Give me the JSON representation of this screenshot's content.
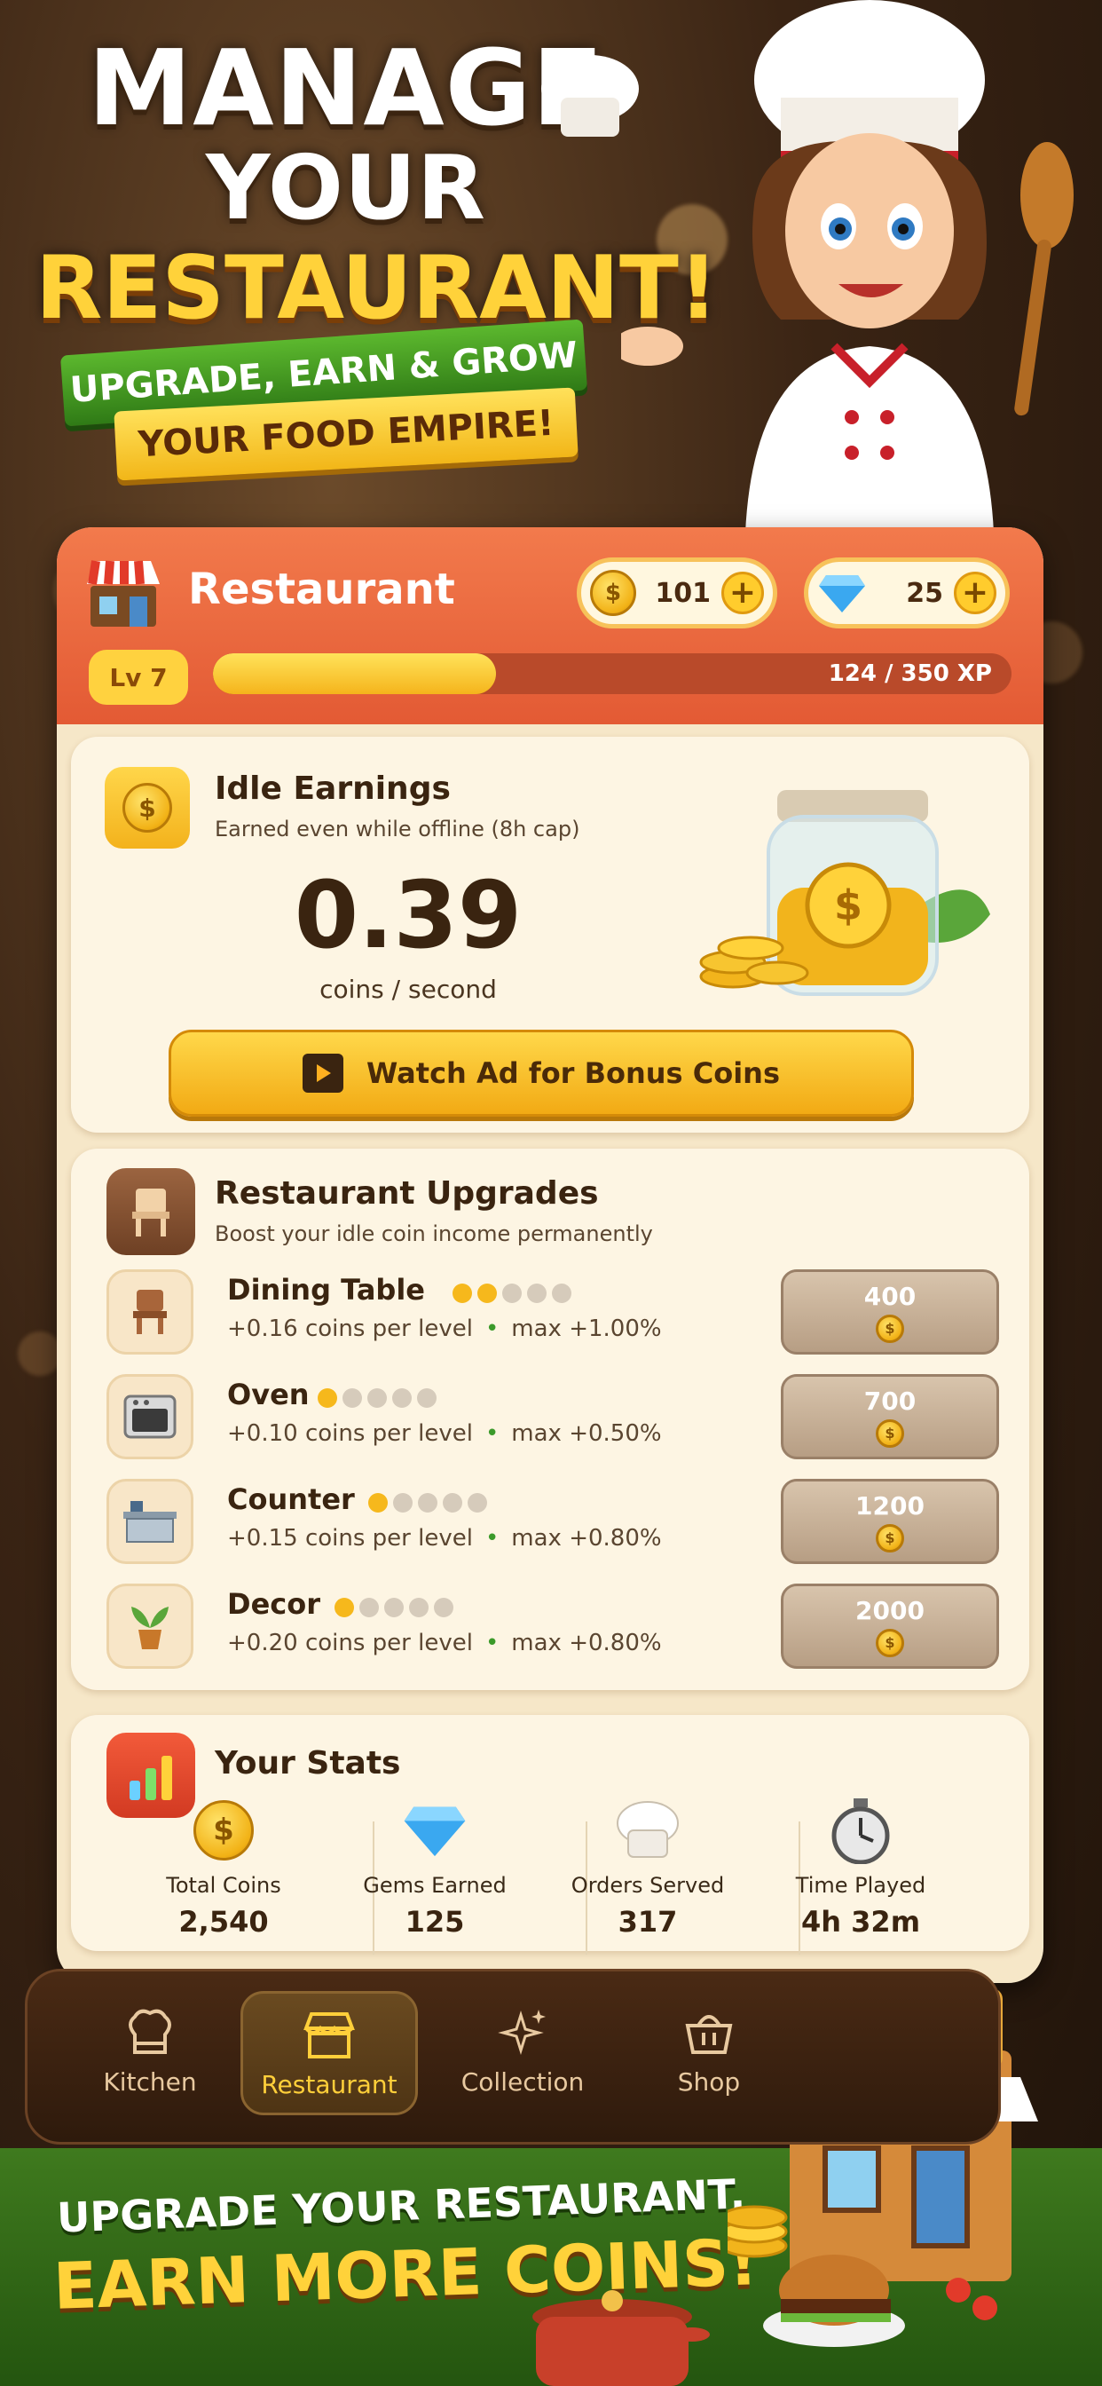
{
  "hero": {
    "title_line1": "MANAGE",
    "title_line2": "YOUR",
    "title_line3": "RESTAURANT!",
    "ribbon_line1": "UPGRADE, EARN & GROW",
    "ribbon_line2": "YOUR FOOD EMPIRE!"
  },
  "header": {
    "title": "Restaurant",
    "coins": "101",
    "gems": "25",
    "level": "Lv 7",
    "xp_text": "124 / 350 XP",
    "xp_progress": 0.354
  },
  "idle": {
    "title": "Idle Earnings",
    "subtitle": "Earned even while offline (8h cap)",
    "rate": "0.39",
    "unit": "coins / second",
    "ad_button": "Watch Ad for Bonus Coins"
  },
  "upgrades": {
    "title": "Restaurant Upgrades",
    "subtitle": "Boost your idle coin income permanently",
    "items": [
      {
        "name": "Dining Table",
        "level": 2,
        "max_level": 5,
        "per_level": "+0.16 coins per level",
        "max": "max +1.00%",
        "cost": "400",
        "icon": "chair-icon"
      },
      {
        "name": "Oven",
        "level": 1,
        "max_level": 5,
        "per_level": "+0.10 coins per level",
        "max": "max +0.50%",
        "cost": "700",
        "icon": "oven-icon"
      },
      {
        "name": "Counter",
        "level": 1,
        "max_level": 5,
        "per_level": "+0.15 coins per level",
        "max": "max +0.80%",
        "cost": "1200",
        "icon": "counter-icon"
      },
      {
        "name": "Decor",
        "level": 1,
        "max_level": 5,
        "per_level": "+0.20 coins per level",
        "max": "max +0.80%",
        "cost": "2000",
        "icon": "plant-icon"
      }
    ]
  },
  "stats": {
    "title": "Your Stats",
    "items": [
      {
        "label": "Total Coins",
        "value": "2,540",
        "icon": "coin-icon"
      },
      {
        "label": "Gems Earned",
        "value": "125",
        "icon": "gem-icon"
      },
      {
        "label": "Orders Served",
        "value": "317",
        "icon": "chef-hat-icon"
      },
      {
        "label": "Time Played",
        "value": "4h 32m",
        "icon": "stopwatch-icon"
      }
    ]
  },
  "nav": {
    "tabs": [
      {
        "label": "Kitchen",
        "icon": "chef-hat-icon"
      },
      {
        "label": "Restaurant",
        "icon": "storefront-icon"
      },
      {
        "label": "Collection",
        "icon": "sparkle-icon"
      },
      {
        "label": "Shop",
        "icon": "basket-icon"
      }
    ],
    "active": "Restaurant"
  },
  "footer": {
    "line1": "UPGRADE YOUR RESTAURANT,",
    "line2": "EARN MORE COINS!"
  },
  "colors": {
    "header": "#e8643c",
    "accent_gold": "#f6b81c",
    "panel_bg": "#f6e7c8",
    "footer_green": "#2f6a16"
  }
}
